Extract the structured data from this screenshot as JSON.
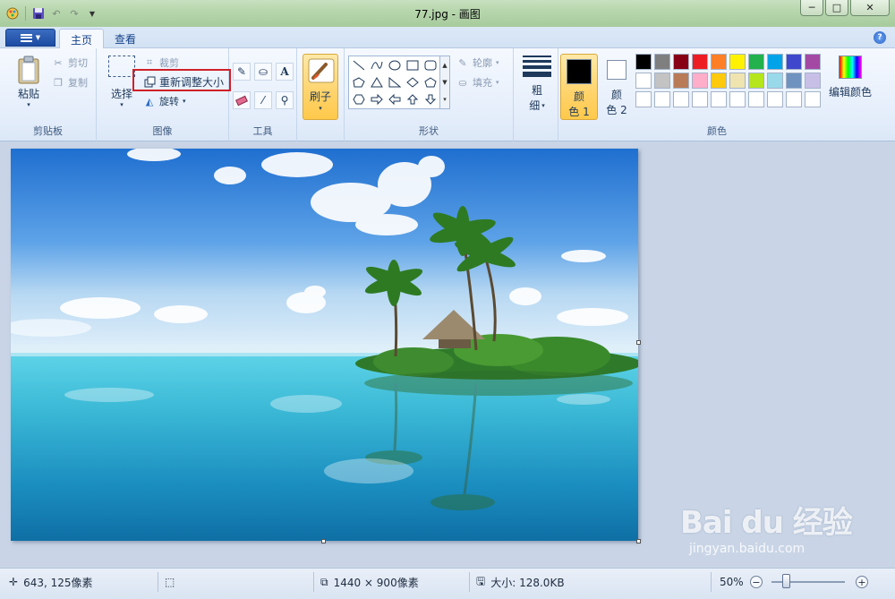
{
  "window": {
    "title": "77.jpg - 画图",
    "min_label": "─",
    "max_label": "□",
    "close_label": "✕"
  },
  "tabs": [
    {
      "label": "主页",
      "active": true
    },
    {
      "label": "查看",
      "active": false
    }
  ],
  "ribbon": {
    "clipboard": {
      "label": "剪贴板",
      "paste": "粘贴",
      "cut": "剪切",
      "copy": "复制"
    },
    "image": {
      "label": "图像",
      "select": "选择",
      "crop": "裁剪",
      "resize": "重新调整大小",
      "rotate": "旋转"
    },
    "tools": {
      "label": "工具",
      "text_tool_glyph": "A"
    },
    "brushes": {
      "label": "刷子"
    },
    "shapes": {
      "label": "形状",
      "outline": "轮廓",
      "fill": "填充"
    },
    "size": {
      "label_line1": "粗",
      "label_line2": "细"
    },
    "colors": {
      "label": "颜色",
      "color1_line1": "颜",
      "color1_line2": "色 1",
      "color2_line1": "颜",
      "color2_line2": "色 2",
      "edit_colors": "编辑颜色",
      "color1_value": "#000000",
      "color2_value": "#ffffff",
      "palette_row1": [
        "#000000",
        "#7f7f7f",
        "#880015",
        "#ed1c24",
        "#ff7f27",
        "#fff200",
        "#22b14c",
        "#00a2e8",
        "#3f48cc",
        "#a349a4"
      ],
      "palette_row2": [
        "#ffffff",
        "#c3c3c3",
        "#b97a57",
        "#ffaec9",
        "#ffc90e",
        "#efe4b0",
        "#b5e61d",
        "#99d9ea",
        "#7092be",
        "#c8bfe7"
      ],
      "palette_row3": [
        "#ffffff",
        "#ffffff",
        "#ffffff",
        "#ffffff",
        "#ffffff",
        "#ffffff",
        "#ffffff",
        "#ffffff",
        "#ffffff",
        "#ffffff"
      ]
    }
  },
  "status": {
    "cursor_pos": "643, 125像素",
    "image_dims": "1440 × 900像素",
    "file_size": "大小: 128.0KB",
    "zoom": "50%",
    "zoom_fraction": 0.2
  },
  "watermark": {
    "logo": "Bai du 经验",
    "url": "jingyan.baidu.com"
  }
}
